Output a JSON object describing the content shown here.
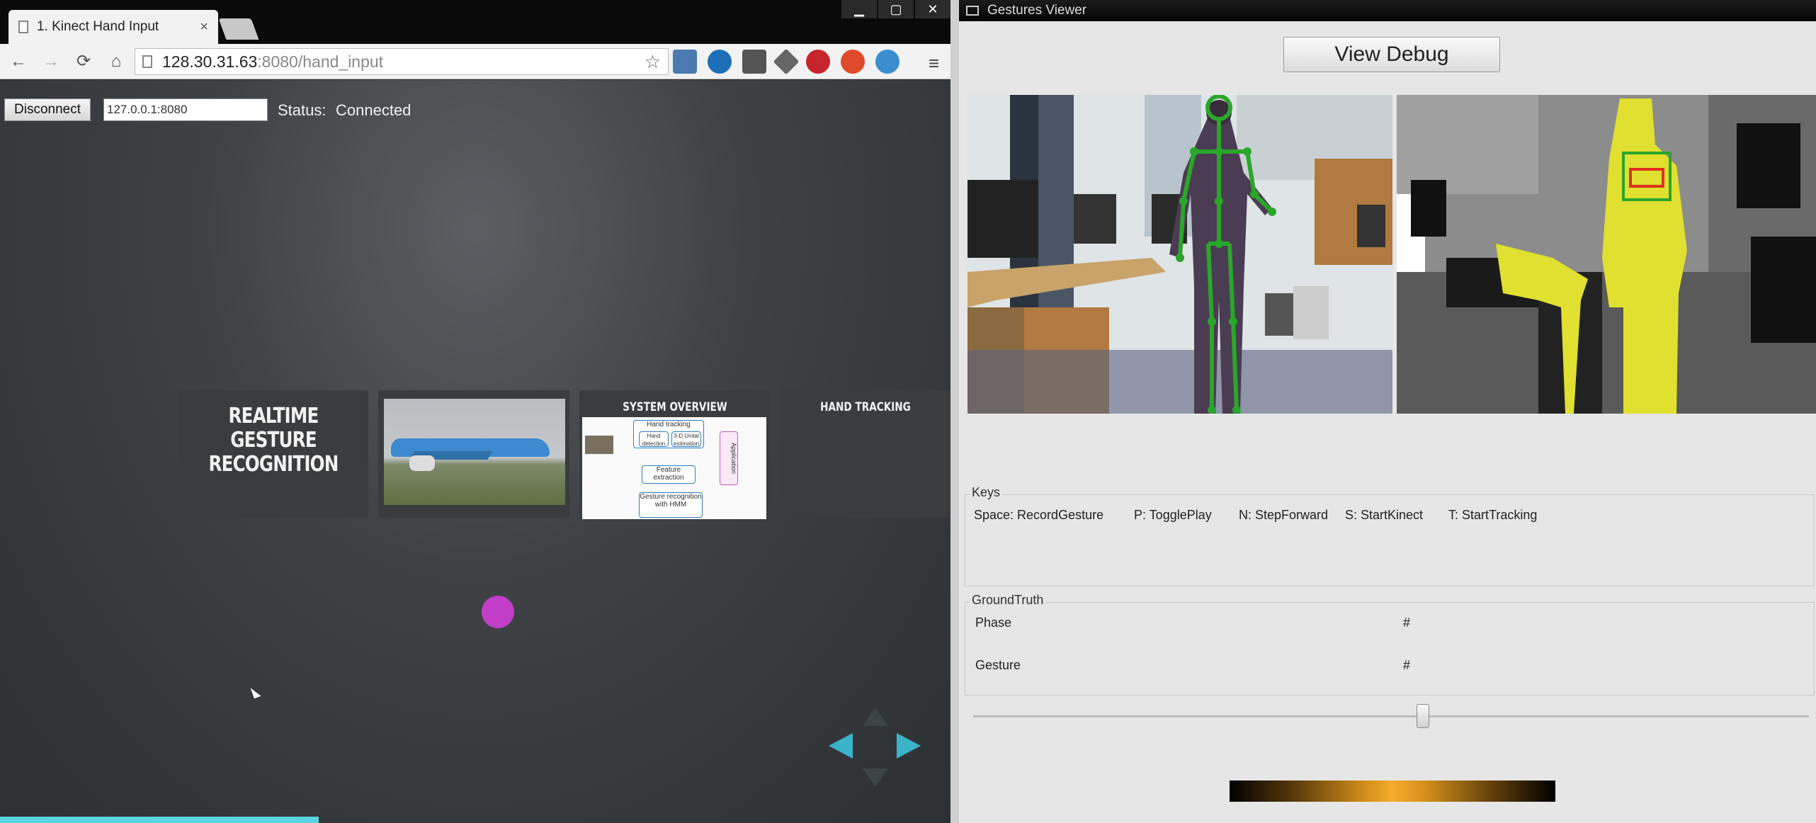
{
  "browser": {
    "tab_title": "1. Kinect Hand Input",
    "tab_close": "×",
    "window_controls": [
      "▁",
      "▢",
      "✕"
    ],
    "nav": {
      "back": "←",
      "forward": "→",
      "reload": "⟳",
      "home": "⌂"
    },
    "url_host": "128.30.31.63",
    "url_path": ":8080/hand_input",
    "star": "☆",
    "menu": "≡"
  },
  "page": {
    "disconnect_label": "Disconnect",
    "server_value": "127.0.0.1:8080",
    "status_label": "Status:",
    "status_value": "Connected",
    "slides": [
      {
        "title": "Realtime Gesture Recognition"
      },
      {
        "title": ""
      },
      {
        "title": "System Overview"
      },
      {
        "title": "Hand Tracking"
      }
    ],
    "diagram": {
      "hand_tracking": "Hand tracking",
      "hand_detection": "Hand detection",
      "tracking": "3-D Unital estimation",
      "feature_extraction": "Feature extraction",
      "gesture_recognition": "Gesture recognition with HMM",
      "application": "Application"
    },
    "accent_color": "#3ab3c8",
    "cursor_color": "#c03ec8"
  },
  "viewer": {
    "title": "Gestures Viewer",
    "debug_button": "View Debug",
    "keys_title": "Keys",
    "keys": [
      "Space: RecordGesture",
      "P: TogglePlay",
      "N: StepForward",
      "S: StartKinect",
      "T: StartTracking"
    ],
    "groundtruth_title": "GroundTruth",
    "phase_label": "Phase",
    "phase_value": "#",
    "gesture_label": "Gesture",
    "gesture_value": "#",
    "skeleton_color": "#2aa62a",
    "user_mask_color": "#e0e030"
  }
}
